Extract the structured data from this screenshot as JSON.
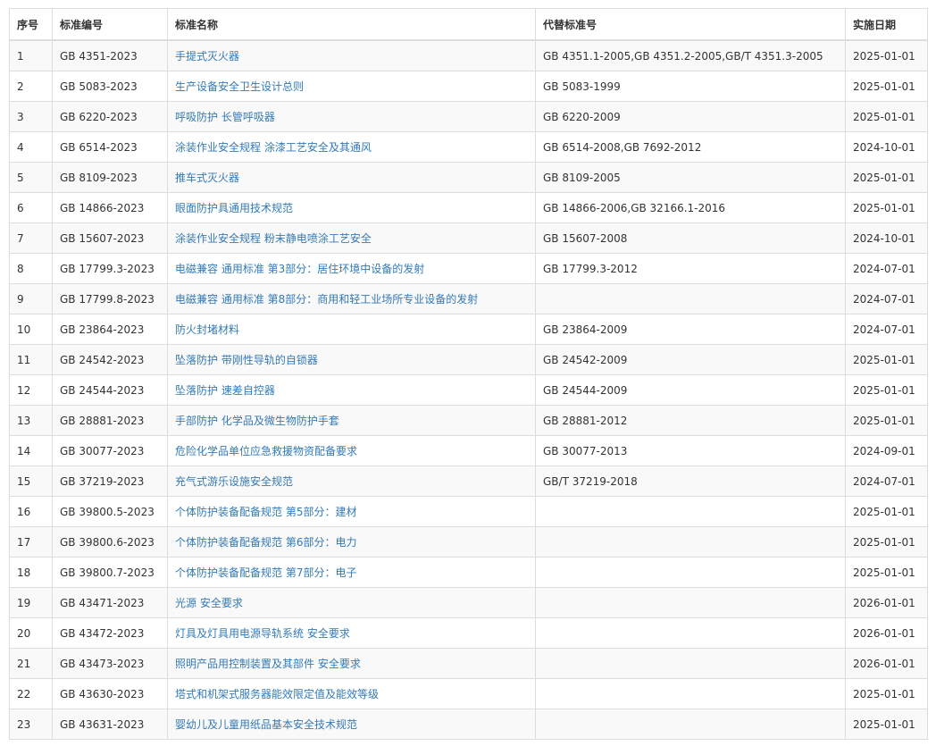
{
  "table": {
    "headers": {
      "seq": "序号",
      "code": "标准编号",
      "name": "标准名称",
      "replaces": "代替标准号",
      "date": "实施日期"
    },
    "rows": [
      {
        "seq": "1",
        "code": "GB 4351-2023",
        "name": "手提式灭火器",
        "replaces": "GB 4351.1-2005,GB 4351.2-2005,GB/T 4351.3-2005",
        "date": "2025-01-01"
      },
      {
        "seq": "2",
        "code": "GB 5083-2023",
        "name": "生产设备安全卫生设计总则",
        "replaces": "GB 5083-1999",
        "date": "2025-01-01"
      },
      {
        "seq": "3",
        "code": "GB 6220-2023",
        "name": "呼吸防护 长管呼吸器",
        "replaces": "GB 6220-2009",
        "date": "2025-01-01"
      },
      {
        "seq": "4",
        "code": "GB 6514-2023",
        "name": "涂装作业安全规程 涂漆工艺安全及其通风",
        "replaces": "GB 6514-2008,GB 7692-2012",
        "date": "2024-10-01"
      },
      {
        "seq": "5",
        "code": "GB 8109-2023",
        "name": "推车式灭火器",
        "replaces": "GB 8109-2005",
        "date": "2025-01-01"
      },
      {
        "seq": "6",
        "code": "GB 14866-2023",
        "name": "眼面防护具通用技术规范",
        "replaces": "GB 14866-2006,GB 32166.1-2016",
        "date": "2025-01-01"
      },
      {
        "seq": "7",
        "code": "GB 15607-2023",
        "name": "涂装作业安全规程 粉末静电喷涂工艺安全",
        "replaces": "GB 15607-2008",
        "date": "2024-10-01"
      },
      {
        "seq": "8",
        "code": "GB 17799.3-2023",
        "name": "电磁兼容 通用标准 第3部分：居住环境中设备的发射",
        "replaces": "GB 17799.3-2012",
        "date": "2024-07-01"
      },
      {
        "seq": "9",
        "code": "GB 17799.8-2023",
        "name": "电磁兼容 通用标准 第8部分：商用和轻工业场所专业设备的发射",
        "replaces": "",
        "date": "2024-07-01"
      },
      {
        "seq": "10",
        "code": "GB 23864-2023",
        "name": "防火封堵材料",
        "replaces": "GB 23864-2009",
        "date": "2024-07-01"
      },
      {
        "seq": "11",
        "code": "GB 24542-2023",
        "name": "坠落防护 带刚性导轨的自锁器",
        "replaces": "GB 24542-2009",
        "date": "2025-01-01"
      },
      {
        "seq": "12",
        "code": "GB 24544-2023",
        "name": "坠落防护 速差自控器",
        "replaces": "GB 24544-2009",
        "date": "2025-01-01"
      },
      {
        "seq": "13",
        "code": "GB 28881-2023",
        "name": "手部防护 化学品及微生物防护手套",
        "replaces": "GB 28881-2012",
        "date": "2025-01-01"
      },
      {
        "seq": "14",
        "code": "GB 30077-2023",
        "name": "危险化学品单位应急救援物资配备要求",
        "replaces": "GB 30077-2013",
        "date": "2024-09-01"
      },
      {
        "seq": "15",
        "code": "GB 37219-2023",
        "name": "充气式游乐设施安全规范",
        "replaces": "GB/T 37219-2018",
        "date": "2024-07-01"
      },
      {
        "seq": "16",
        "code": "GB 39800.5-2023",
        "name": "个体防护装备配备规范 第5部分：建材",
        "replaces": "",
        "date": "2025-01-01"
      },
      {
        "seq": "17",
        "code": "GB 39800.6-2023",
        "name": "个体防护装备配备规范 第6部分：电力",
        "replaces": "",
        "date": "2025-01-01"
      },
      {
        "seq": "18",
        "code": "GB 39800.7-2023",
        "name": "个体防护装备配备规范 第7部分：电子",
        "replaces": "",
        "date": "2025-01-01"
      },
      {
        "seq": "19",
        "code": "GB 43471-2023",
        "name": "光源 安全要求",
        "replaces": "",
        "date": "2026-01-01"
      },
      {
        "seq": "20",
        "code": "GB 43472-2023",
        "name": "灯具及灯具用电源导轨系统 安全要求",
        "replaces": "",
        "date": "2026-01-01"
      },
      {
        "seq": "21",
        "code": "GB 43473-2023",
        "name": "照明产品用控制装置及其部件 安全要求",
        "replaces": "",
        "date": "2026-01-01"
      },
      {
        "seq": "22",
        "code": "GB 43630-2023",
        "name": "塔式和机架式服务器能效限定值及能效等级",
        "replaces": "",
        "date": "2025-01-01"
      },
      {
        "seq": "23",
        "code": "GB 43631-2023",
        "name": "婴幼儿及儿童用纸品基本安全技术规范",
        "replaces": "",
        "date": "2025-01-01"
      }
    ]
  },
  "colors": {
    "link": "#337ab7",
    "border": "#dddddd",
    "stripe": "#f9f9f9",
    "text": "#333333"
  }
}
